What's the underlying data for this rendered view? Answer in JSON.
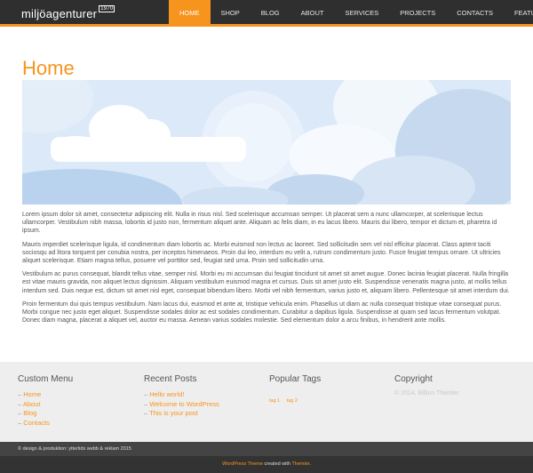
{
  "header": {
    "logo_text": "miljöagenturer",
    "logo_sup": "1970",
    "nav": [
      "HOME",
      "SHOP",
      "BLOG",
      "ABOUT",
      "SERVICES",
      "PROJECTS",
      "CONTACTS",
      "FEATURES"
    ]
  },
  "main": {
    "title": "Home",
    "paragraphs": [
      "Lorem ipsum dolor sit amet, consectetur adipiscing elit. Nulla in risus nisl. Sed scelerisque accumsan semper. Ut placerat sem a nunc ullamcorper, at scelerisque lectus ullamcorper. Vestibulum nibh massa, lobortis id justo non, fermentum aliquet ante. Aliquam ac felis diam, in eu lacus libero. Mauris dui libero, tempor et dictum et, pharetra id ipsum.",
      "Mauris imperdiet scelerisque ligula, id condimentum diam lobortis ac. Morbi euismod non lectus ac laoreet. Sed sollicitudin sem vel nisl efficitur placerat. Class aptent taciti sociosqu ad litora torquent per conubia nostra, per inceptos himenaeos. Proin dui leo, interdum eu velit a, rutrum condimentum justo. Fusce feugiat tempus ornare. Ut ultricies aliquet scelerisque. Etiam magna tellus, posuere vel porttitor sed, feugiat sed urna. Proin sed sollicitudin urna.",
      "Vestibulum ac purus consequat, blandit tellus vitae, semper nisl. Morbi eu mi accumsan dui feugiat tincidunt sit amet sit amet augue. Donec lacinia feugiat placerat. Nulla fringilla est vitae mauris gravida, non aliquet lectus dignissim. Aliquam vestibulum euismod magna et cursus. Duis sit amet justo elit. Suspendisse venenatis magna justo, at mollis tellus interdum sed. Duis neque est, dictum sit amet nisl eget, consequat bibendum libero. Morbi vel nibh fermentum, varius justo et, aliquam libero. Pellentesque sit amet interdum dui.",
      "Proin fermentum dui quis tempus vestibulum. Nam lacus dui, euismod et ante at, tristique vehicula enim. Phasellus ut diam ac nulla consequat tristique vitae consequat purus. Morbi congue nec justo eget aliquet. Suspendisse sodales dolor ac est sodales condimentum. Curabitur a dapibus ligula. Suspendisse at quam sed lacus fermentum volutpat. Donec diam magna, placerat a aliquet vel, auctor eu massa. Aenean varius sodales molestie. Sed elementum dolor a arcu finibus, in hendrerit ante mollis."
    ]
  },
  "footer": {
    "custom_menu": {
      "title": "Custom Menu",
      "items": [
        "Home",
        "About",
        "Blog",
        "Contacts"
      ]
    },
    "recent_posts": {
      "title": "Recent Posts",
      "items": [
        "Hello world!",
        "Welcome to WordPress",
        "This is your post"
      ]
    },
    "popular_tags": {
      "title": "Popular Tags",
      "tags": [
        "tag 1",
        "tag 2"
      ]
    },
    "copyright": {
      "title": "Copyright",
      "text": "© 2014, Billion Themler"
    }
  },
  "credits": {
    "text": "© design & produktion: ytterlids webb & reklam 2015",
    "theme_link": "WordPress Theme",
    "created_with": " created with ",
    "themler_link": "Themler",
    "period": "."
  },
  "colors": {
    "accent": "#f7941d",
    "nav_bg": "#2f2f2f",
    "footer_bg": "#eeeeee"
  }
}
